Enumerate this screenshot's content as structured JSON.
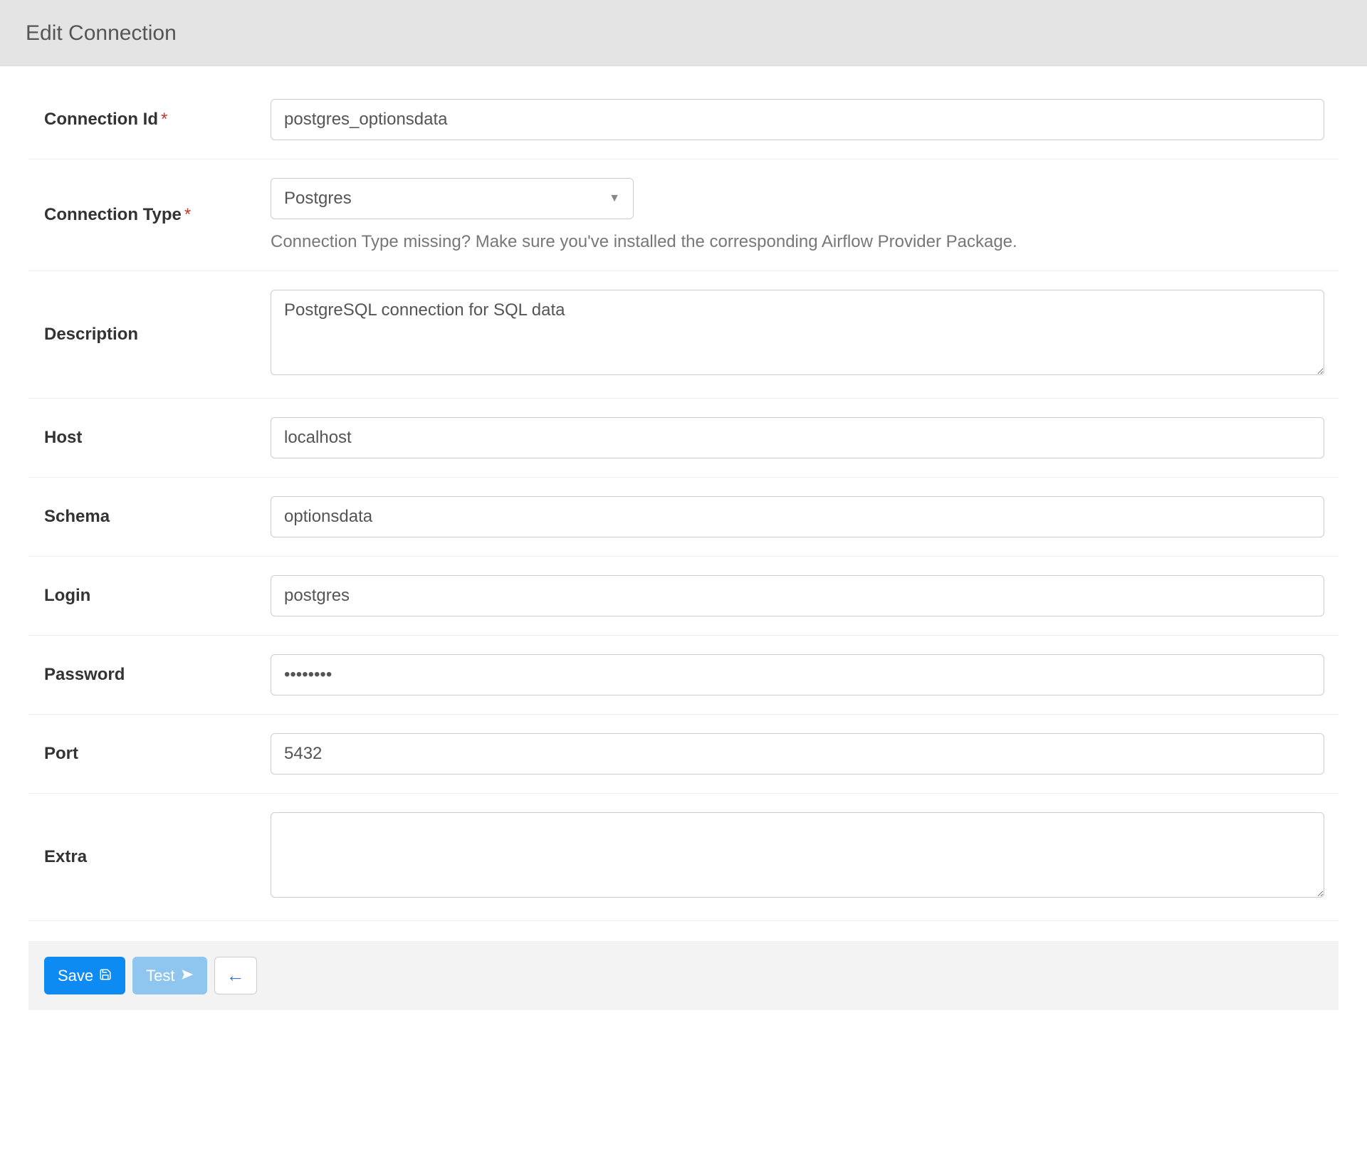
{
  "header": {
    "title": "Edit Connection"
  },
  "fields": {
    "conn_id": {
      "label": "Connection Id",
      "value": "postgres_optionsdata",
      "required": true
    },
    "conn_type": {
      "label": "Connection Type",
      "value": "Postgres",
      "required": true,
      "hint": "Connection Type missing? Make sure you've installed the corresponding Airflow Provider Package."
    },
    "description": {
      "label": "Description",
      "value": "PostgreSQL connection for SQL data"
    },
    "host": {
      "label": "Host",
      "value": "localhost"
    },
    "schema": {
      "label": "Schema",
      "value": "optionsdata"
    },
    "login": {
      "label": "Login",
      "value": "postgres"
    },
    "password": {
      "label": "Password",
      "value": "••••••••"
    },
    "port": {
      "label": "Port",
      "value": "5432"
    },
    "extra": {
      "label": "Extra",
      "value": ""
    }
  },
  "buttons": {
    "save": "Save",
    "test": "Test",
    "back_glyph": "←"
  }
}
